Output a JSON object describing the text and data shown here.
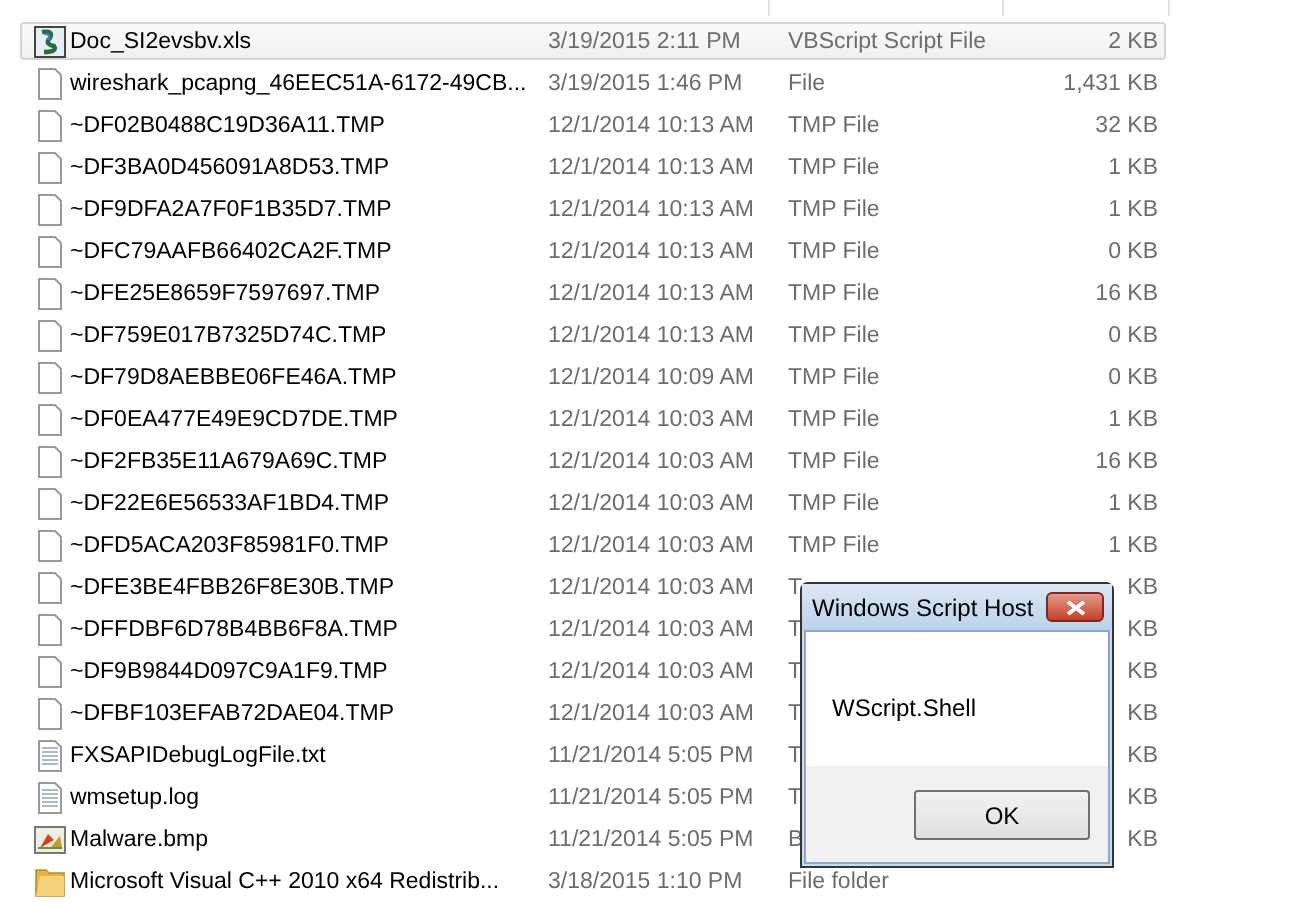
{
  "files": [
    {
      "name": "Doc_SI2evsbv.xls",
      "date": "3/19/2015 2:11 PM",
      "type": "VBScript Script File",
      "size": "2 KB",
      "kind": "script",
      "selected": true
    },
    {
      "name": "wireshark_pcapng_46EEC51A-6172-49CB...",
      "date": "3/19/2015 1:46 PM",
      "type": "File",
      "size": "1,431 KB",
      "kind": "blank",
      "selected": false
    },
    {
      "name": "~DF02B0488C19D36A11.TMP",
      "date": "12/1/2014 10:13 AM",
      "type": "TMP File",
      "size": "32 KB",
      "kind": "blank",
      "selected": false
    },
    {
      "name": "~DF3BA0D456091A8D53.TMP",
      "date": "12/1/2014 10:13 AM",
      "type": "TMP File",
      "size": "1 KB",
      "kind": "blank",
      "selected": false
    },
    {
      "name": "~DF9DFA2A7F0F1B35D7.TMP",
      "date": "12/1/2014 10:13 AM",
      "type": "TMP File",
      "size": "1 KB",
      "kind": "blank",
      "selected": false
    },
    {
      "name": "~DFC79AAFB66402CA2F.TMP",
      "date": "12/1/2014 10:13 AM",
      "type": "TMP File",
      "size": "0 KB",
      "kind": "blank",
      "selected": false
    },
    {
      "name": "~DFE25E8659F7597697.TMP",
      "date": "12/1/2014 10:13 AM",
      "type": "TMP File",
      "size": "16 KB",
      "kind": "blank",
      "selected": false
    },
    {
      "name": "~DF759E017B7325D74C.TMP",
      "date": "12/1/2014 10:13 AM",
      "type": "TMP File",
      "size": "0 KB",
      "kind": "blank",
      "selected": false
    },
    {
      "name": "~DF79D8AEBBE06FE46A.TMP",
      "date": "12/1/2014 10:09 AM",
      "type": "TMP File",
      "size": "0 KB",
      "kind": "blank",
      "selected": false
    },
    {
      "name": "~DF0EA477E49E9CD7DE.TMP",
      "date": "12/1/2014 10:03 AM",
      "type": "TMP File",
      "size": "1 KB",
      "kind": "blank",
      "selected": false
    },
    {
      "name": "~DF2FB35E11A679A69C.TMP",
      "date": "12/1/2014 10:03 AM",
      "type": "TMP File",
      "size": "16 KB",
      "kind": "blank",
      "selected": false
    },
    {
      "name": "~DF22E6E56533AF1BD4.TMP",
      "date": "12/1/2014 10:03 AM",
      "type": "TMP File",
      "size": "1 KB",
      "kind": "blank",
      "selected": false
    },
    {
      "name": "~DFD5ACA203F85981F0.TMP",
      "date": "12/1/2014 10:03 AM",
      "type": "TMP File",
      "size": "1 KB",
      "kind": "blank",
      "selected": false
    },
    {
      "name": "~DFE3BE4FBB26F8E30B.TMP",
      "date": "12/1/2014 10:03 AM",
      "type": "T",
      "size": "KB",
      "kind": "blank",
      "selected": false
    },
    {
      "name": "~DFFDBF6D78B4BB6F8A.TMP",
      "date": "12/1/2014 10:03 AM",
      "type": "T",
      "size": "KB",
      "kind": "blank",
      "selected": false
    },
    {
      "name": "~DF9B9844D097C9A1F9.TMP",
      "date": "12/1/2014 10:03 AM",
      "type": "T",
      "size": "KB",
      "kind": "blank",
      "selected": false
    },
    {
      "name": "~DFBF103EFAB72DAE04.TMP",
      "date": "12/1/2014 10:03 AM",
      "type": "T",
      "size": "KB",
      "kind": "blank",
      "selected": false
    },
    {
      "name": "FXSAPIDebugLogFile.txt",
      "date": "11/21/2014 5:05 PM",
      "type": "T",
      "size": "KB",
      "kind": "text",
      "selected": false
    },
    {
      "name": "wmsetup.log",
      "date": "11/21/2014 5:05 PM",
      "type": "T",
      "size": "KB",
      "kind": "text",
      "selected": false
    },
    {
      "name": "Malware.bmp",
      "date": "11/21/2014 5:05 PM",
      "type": "B",
      "size": "KB",
      "kind": "image",
      "selected": false
    },
    {
      "name": "Microsoft Visual C++ 2010  x64 Redistrib...",
      "date": "3/18/2015 1:10 PM",
      "type": "File folder",
      "kind": "folder",
      "selected": false
    }
  ],
  "dialog": {
    "title": "Windows Script Host",
    "message": "WScript.Shell",
    "button": "OK"
  }
}
